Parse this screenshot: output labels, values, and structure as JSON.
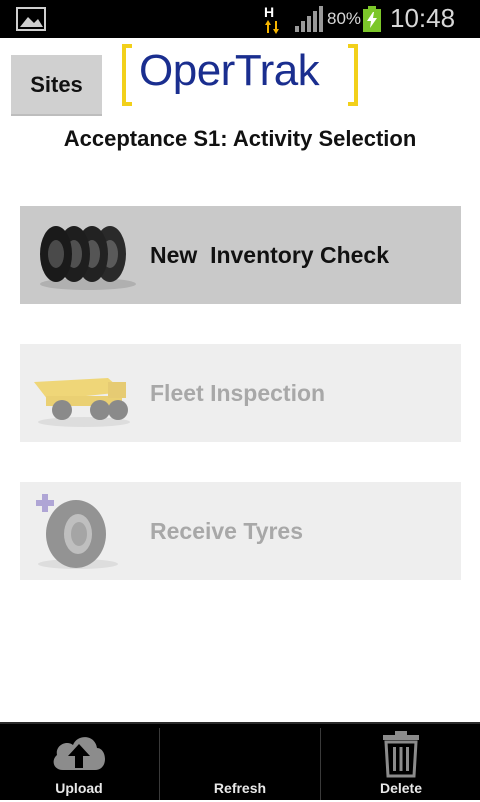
{
  "status_bar": {
    "network_type": "H",
    "battery_percent": "80%",
    "time": "10:48"
  },
  "header": {
    "sites_label": "Sites",
    "logo_text": "OperTrak",
    "page_title": "Acceptance S1: Activity Selection"
  },
  "activities": [
    {
      "label": "New  Inventory Check",
      "enabled": true,
      "icon": "tyre-stack-icon"
    },
    {
      "label": "Fleet Inspection",
      "enabled": false,
      "icon": "dump-truck-icon"
    },
    {
      "label": "Receive Tyres",
      "enabled": false,
      "icon": "tyre-add-icon"
    }
  ],
  "bottom_bar": {
    "upload_label": "Upload",
    "refresh_label": "Refresh",
    "delete_label": "Delete"
  },
  "colors": {
    "logo_blue": "#1a2e8f",
    "logo_bracket": "#f2d01a",
    "enabled_bg": "#c9c9c9",
    "disabled_bg": "#eeeeee"
  }
}
